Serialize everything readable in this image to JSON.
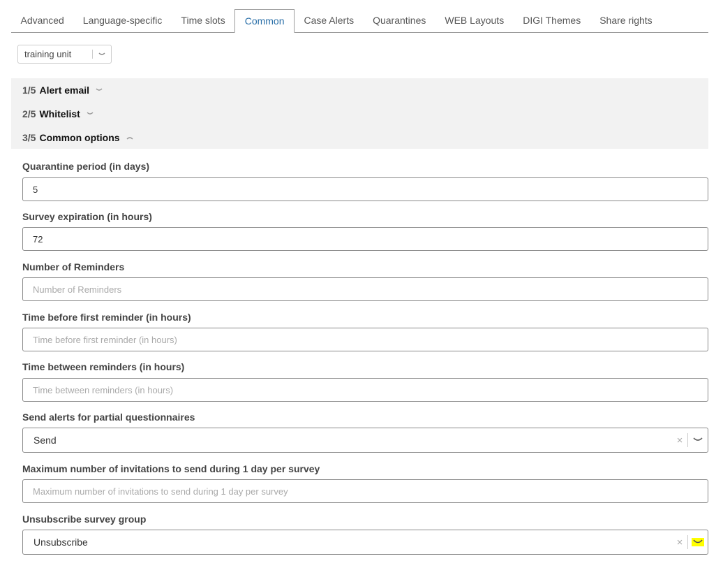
{
  "tabs": [
    "Advanced",
    "Language-specific",
    "Time slots",
    "Common",
    "Case Alerts",
    "Quarantines",
    "WEB Layouts",
    "DIGI Themes",
    "Share rights"
  ],
  "unit_select": {
    "value": "training unit"
  },
  "accordion": [
    {
      "num": "1/5",
      "title": "Alert email",
      "expanded": false
    },
    {
      "num": "2/5",
      "title": "Whitelist",
      "expanded": false
    },
    {
      "num": "3/5",
      "title": "Common options",
      "expanded": true
    }
  ],
  "fields": {
    "quarantine": {
      "label": "Quarantine period (in days)",
      "value": "5",
      "placeholder": ""
    },
    "survey_exp": {
      "label": "Survey expiration (in hours)",
      "value": "72",
      "placeholder": ""
    },
    "reminders": {
      "label": "Number of Reminders",
      "value": "",
      "placeholder": "Number of Reminders"
    },
    "first_reminder": {
      "label": "Time before first reminder (in hours)",
      "value": "",
      "placeholder": "Time before first reminder (in hours)"
    },
    "between_reminders": {
      "label": "Time between reminders (in hours)",
      "value": "",
      "placeholder": "Time between reminders (in hours)"
    },
    "partial_alerts": {
      "label": "Send alerts for partial questionnaires",
      "value": "Send",
      "clear": "×"
    },
    "max_invitations": {
      "label": "Maximum number of invitations to send during 1 day per survey",
      "value": "",
      "placeholder": "Maximum number of invitations to send during 1 day per survey"
    },
    "unsubscribe": {
      "label": "Unsubscribe survey group",
      "value": "Unsubscribe",
      "clear": "×"
    }
  },
  "colors": {
    "active_tab": "#2a6fa8",
    "accordion_bg": "#f2f2f2",
    "highlight": "#ffff00"
  }
}
